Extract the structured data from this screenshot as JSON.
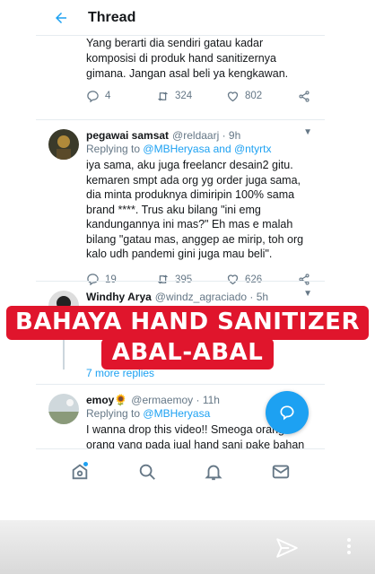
{
  "header": {
    "title": "Thread",
    "back_icon": "arrow-left-icon"
  },
  "top_tweet": {
    "text": "Yang berarti dia sendiri gatau kadar komposisi di produk hand sanitizernya gimana.  Jangan asal beli ya kengkawan.",
    "replies": "4",
    "retweets": "324",
    "likes": "802"
  },
  "tweets": [
    {
      "name": "pegawai samsat",
      "handle": "@reldaarj · 9h",
      "replying_prefix": "Replying to",
      "replying_to": "@MBHeryasa and @ntyrtx",
      "text": "iya sama, aku juga freelancr desain2 gitu. kemaren smpt ada org yg order juga sama, dia minta produknya dimiripin 100% sama brand ****. Trus aku bilang \"ini emg kandungannya ini mas?\" Eh mas e malah bilang \"gatau mas, anggep ae mirip, toh org kalo udh pandemi gini juga mau beli\".",
      "replies": "19",
      "retweets": "395",
      "likes": "626"
    },
    {
      "name": "Windhy Arya",
      "handle": "@windz_agraciado · 5h",
      "more_replies": "7 more replies"
    },
    {
      "name": "emoy🌻",
      "handle": "@ermaemoy · 11h",
      "replying_prefix": "Replying to",
      "replying_to": "@MBHeryasa",
      "text": "I wanna drop this video!! Smeoga orang2 orang yang pada jual hand sani pake bahan"
    }
  ],
  "overlay": {
    "line1": "BAHAYA HAND SANITIZER",
    "line2": "ABAL-ABAL",
    "color": "#e0152c"
  },
  "accent": "#1da1f2",
  "bottom_nav": [
    "home-icon",
    "search-icon",
    "bell-icon",
    "mail-icon"
  ]
}
